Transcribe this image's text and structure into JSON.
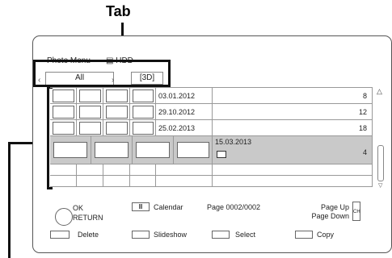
{
  "annotations": {
    "tab_label": "Tab"
  },
  "header": {
    "menu_title": "Photo Menu",
    "drive": "HDD"
  },
  "tabs": [
    {
      "label": "All"
    },
    {
      "label": "3D"
    }
  ],
  "rows": [
    {
      "date": "03.01.2012",
      "count": "8"
    },
    {
      "date": "29.10.2012",
      "count": "12"
    },
    {
      "date": "25.02.2013",
      "count": "18"
    },
    {
      "date": "15.03.2013",
      "count": "4"
    }
  ],
  "footer": {
    "ok": "OK",
    "return": "RETURN",
    "calendar": "Calendar",
    "page_status": "Page 0002/0002",
    "page_up": "Page Up",
    "page_down": "Page Down",
    "ch": "CH"
  },
  "color_buttons": {
    "red": "Delete",
    "green": "Slideshow",
    "yellow": "Select",
    "blue": "Copy"
  }
}
